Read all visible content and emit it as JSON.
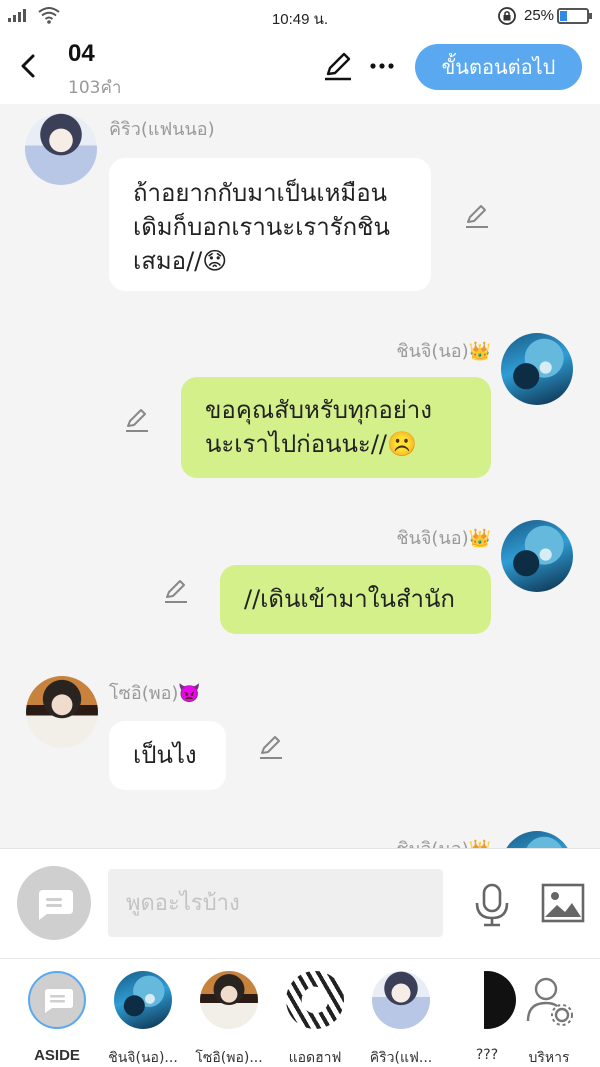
{
  "status_bar": {
    "time": "10:49 น.",
    "battery": "25%",
    "battery_level": 0.25
  },
  "header": {
    "title": "04",
    "word_count": "103คำ",
    "next_button": "ขั้นตอนต่อไป"
  },
  "messages": [
    {
      "sender": "คิริว(แฟนนอ)",
      "side": "left",
      "avatar": "kiriw-avatar",
      "lines": [
        "ถ้าอยากกับมาเป็นเหมือน",
        "เดิมก็บอกเรานะเรารักชิน",
        "เสมอ//😟"
      ]
    },
    {
      "sender": "ชินจิ(นอ)👑",
      "side": "right",
      "avatar": "chinji-avatar",
      "lines": [
        "ขอคุณสับหรับทุกอย่าง",
        "นะเราไปก่อนนะ//☹️"
      ]
    },
    {
      "sender": "ชินจิ(นอ)👑",
      "side": "right",
      "avatar": "chinji-avatar",
      "lines": [
        "//เดินเข้ามาในสำนัก"
      ]
    },
    {
      "sender": "โซอิ(พอ)👿",
      "side": "left",
      "avatar": "soi-avatar",
      "lines": [
        "เป็นไง"
      ]
    },
    {
      "sender": "ชินจิ(นอ)👑",
      "side": "right",
      "avatar": "chinji-avatar",
      "lines": []
    }
  ],
  "input": {
    "placeholder": "พูดอะไรบ้าง"
  },
  "cast": [
    {
      "label": "ASIDE",
      "icon": "chat-bubble-icon"
    },
    {
      "label": "ชินจิ(นอ)...",
      "icon": "chinji-avatar"
    },
    {
      "label": "โซอิ(พอ)...",
      "icon": "soi-avatar"
    },
    {
      "label": "แอดฮาฟ",
      "icon": "manga-avatar"
    },
    {
      "label": "คิริว(แฟ...",
      "icon": "kiriw-avatar"
    },
    {
      "label": "???",
      "icon": "dark-avatar"
    },
    {
      "label": "บริหาร",
      "icon": "person-gear-icon"
    }
  ],
  "colors": {
    "accent": "#5aa8f0",
    "green_bubble": "#d4f08a",
    "white_bubble": "#ffffff",
    "background": "#f4f4f4"
  }
}
